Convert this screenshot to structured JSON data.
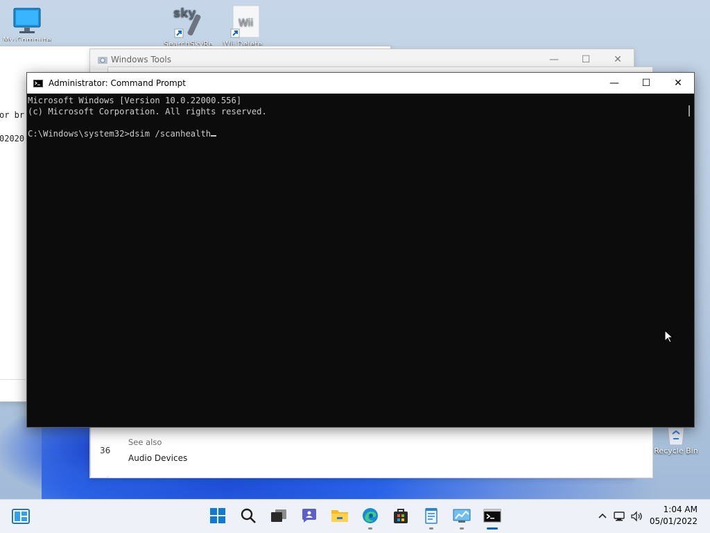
{
  "desktop": {
    "icons": [
      {
        "label": "My Computer",
        "icon": "monitor-icon"
      },
      {
        "label": "SearchSkyRe...",
        "icon": "sky-remote-icon"
      },
      {
        "label": "Wii Delete",
        "icon": "wii-icon"
      },
      {
        "label": "Recycle Bin",
        "icon": "recycle-bin-icon"
      }
    ]
  },
  "bg_window_left": {
    "fragments": [
      "or br",
      "02020"
    ]
  },
  "windows_tools": {
    "title": "Windows Tools",
    "see_also": "See also",
    "link": "Audio Devices",
    "fragment": "36"
  },
  "cmd": {
    "title": "Administrator: Command Prompt",
    "lines": [
      "Microsoft Windows [Version 10.0.22000.556]",
      "(c) Microsoft Corporation. All rights reserved.",
      "",
      "C:\\Windows\\system32>dsim /scanhealth"
    ]
  },
  "taskbar": {
    "apps": [
      "start-icon",
      "search-icon",
      "task-view-icon",
      "chat-icon",
      "file-explorer-icon",
      "edge-icon",
      "store-icon",
      "notepad-icon",
      "control-panel-icon",
      "command-prompt-icon"
    ],
    "time": "1:04 AM",
    "date": "05/01/2022"
  },
  "colors": {
    "console_bg": "#0c0c0c",
    "console_text": "#cccccc",
    "accent": "#0067c0"
  }
}
